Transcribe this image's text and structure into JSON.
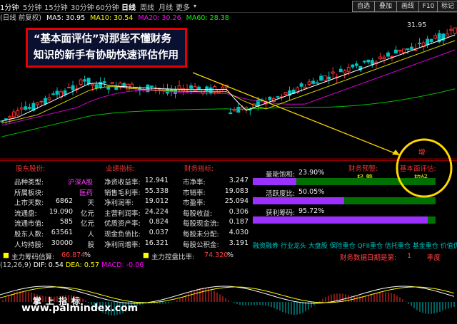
{
  "toolbar": {
    "timeframes": [
      "1分钟",
      "5分钟",
      "15分钟",
      "30分钟",
      "60分钟",
      "日线",
      "周线",
      "月线",
      "更多"
    ],
    "arrow": "▾",
    "buttons": [
      "自选",
      "叠加",
      "画线",
      "F10",
      "标记"
    ]
  },
  "ma_legend": {
    "title": "(日线 前复权)",
    "ma5": "MA5: 30.95",
    "ma10": "MA10: 30.54",
    "ma20": "MA20: 30.26",
    "ma60": "MA60: 28.38",
    "colors": {
      "ma5": "#ffffff",
      "ma10": "#ffff00",
      "ma20": "#ff00ff",
      "ma60": "#00ff00"
    }
  },
  "price_high_label": "31.95",
  "callout": {
    "line1": "“基本面评估”对那些不懂财务",
    "line2": "知识的新手有协助快速评估作用"
  },
  "panel": {
    "sections": {
      "stock": "股东股份:",
      "industry": "业绩指标:",
      "finance": "财务指标:",
      "warning": "财务预警:",
      "eval": "基本面评估:"
    },
    "col1": [
      {
        "label": "品种类型:",
        "value": "沪深A股",
        "unit": ""
      },
      {
        "label": "所属板块:",
        "value": "医药",
        "unit": ""
      },
      {
        "label": "上市天数:",
        "value": "6862",
        "unit": "天"
      },
      {
        "label": "流通盘:",
        "value": "19.090",
        "unit": "亿元"
      },
      {
        "label": "流通市值:",
        "value": "585",
        "unit": "亿元"
      },
      {
        "label": "股东人数:",
        "value": "63561",
        "unit": "人"
      },
      {
        "label": "人均持股:",
        "value": "30000",
        "unit": "股"
      }
    ],
    "col2": [
      {
        "label": "净资收益率:",
        "value": "12.941"
      },
      {
        "label": "销售毛利率:",
        "value": "55.338"
      },
      {
        "label": "净利润率:",
        "value": "19.012"
      },
      {
        "label": "主营利润率:",
        "value": "24.224"
      },
      {
        "label": "优质资产率:",
        "value": "0.824"
      },
      {
        "label": "现金负债比:",
        "value": "0.037"
      },
      {
        "label": "净利同增率:",
        "value": "16.321"
      }
    ],
    "col3": [
      {
        "label": "市净率:",
        "value": "3.247"
      },
      {
        "label": "市销率:",
        "value": "19.083"
      },
      {
        "label": "市盈率:",
        "value": "25.094"
      },
      {
        "label": "每股收益:",
        "value": "0.306"
      },
      {
        "label": "每股现金流:",
        "value": "0.187"
      },
      {
        "label": "每股未分配:",
        "value": "4.030"
      },
      {
        "label": "每股公积金:",
        "value": "3.191"
      }
    ],
    "bars": [
      {
        "label": "量能饱和:",
        "value": "23.90%",
        "fill": 0.239
      },
      {
        "label": "活跃度比:",
        "value": "50.05%",
        "fill": 0.5005
      },
      {
        "label": "获利筹码:",
        "value": "95.72%",
        "fill": 0.9572
      }
    ],
    "warning_value": "轻 警",
    "eval_value": "较好",
    "mark_char": "增",
    "concepts": "融资融券 行业龙头 大盘股 保险重仓 QFII重仓 信托重仓 基金重仓 价值优势 沪",
    "report_date_label": "财务数据日期是第:",
    "report_date_value": "1",
    "report_date_unit": "季度",
    "chips_est_label": "主力筹码估算:",
    "chips_est_value": "66.874",
    "chips_est_unit": "%",
    "control_label": "主力控盘比率:",
    "control_value": "74.320",
    "control_unit": "%"
  },
  "macd": {
    "params": "(12,26,9)",
    "dif": "DIF: 0.54",
    "dea": "DEA: 0.57",
    "macd": "MACD: -0.06"
  },
  "watermark": {
    "logo": "掌上指标",
    "url": "www.palmindex.com"
  }
}
